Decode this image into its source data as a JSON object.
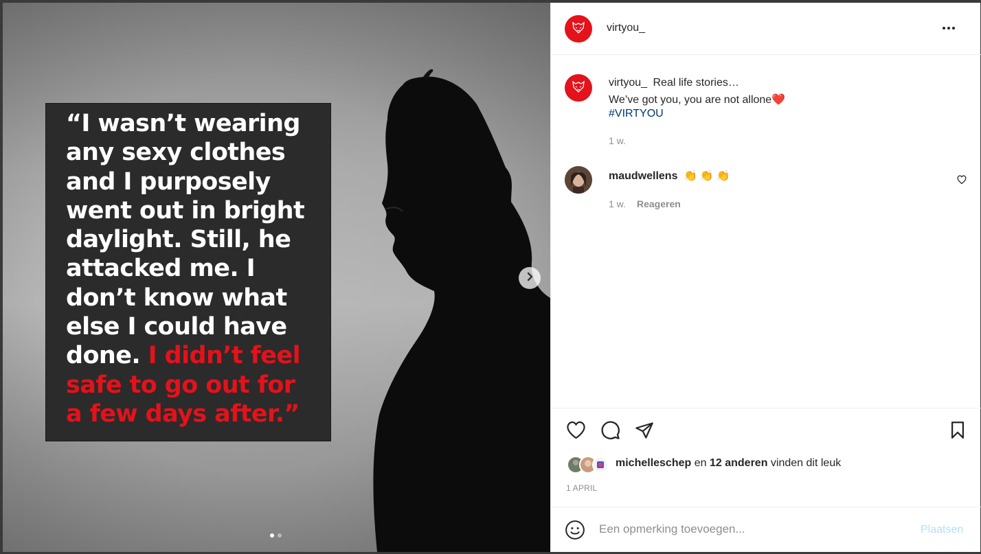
{
  "post": {
    "author": "virtyou_",
    "quote_white": "“I wasn’t wearing any sexy clothes and I purposely went out in bright daylight. Still, he attacked me. I don’t know what else I could have done. ",
    "quote_red": "I didn’t feel safe to go out for a few days after.”"
  },
  "caption": {
    "username": "virtyou_",
    "line1": "Real life stories…",
    "line2": "We’ve got you, you are not allone",
    "line2_emoji": "❤️",
    "hashtag": "#VIRTYOU",
    "time": "1 w."
  },
  "comment": {
    "username": "maudwellens",
    "text": "👏👏👏",
    "time": "1 w.",
    "reply_label": "Reageren"
  },
  "likes": {
    "user": "michelleschep",
    "connector": "en",
    "others": "12 anderen",
    "suffix": "vinden dit leuk"
  },
  "date": "1 APRIL",
  "comment_input": {
    "placeholder": "Een opmerking toevoegen...",
    "post_label": "Plaatsen"
  },
  "icons": {
    "next": "chevron-right-icon",
    "more": "more-horizontal-icon",
    "like": "heart-icon",
    "comment": "comment-bubble-icon",
    "share": "paper-plane-icon",
    "save": "bookmark-icon",
    "emoji": "smiley-icon"
  },
  "colors": {
    "brand_red": "#e3121b",
    "link_blue": "#00376b",
    "post_button_disabled": "#b2dffc"
  },
  "carousel": {
    "slides": 2,
    "active": 1
  }
}
